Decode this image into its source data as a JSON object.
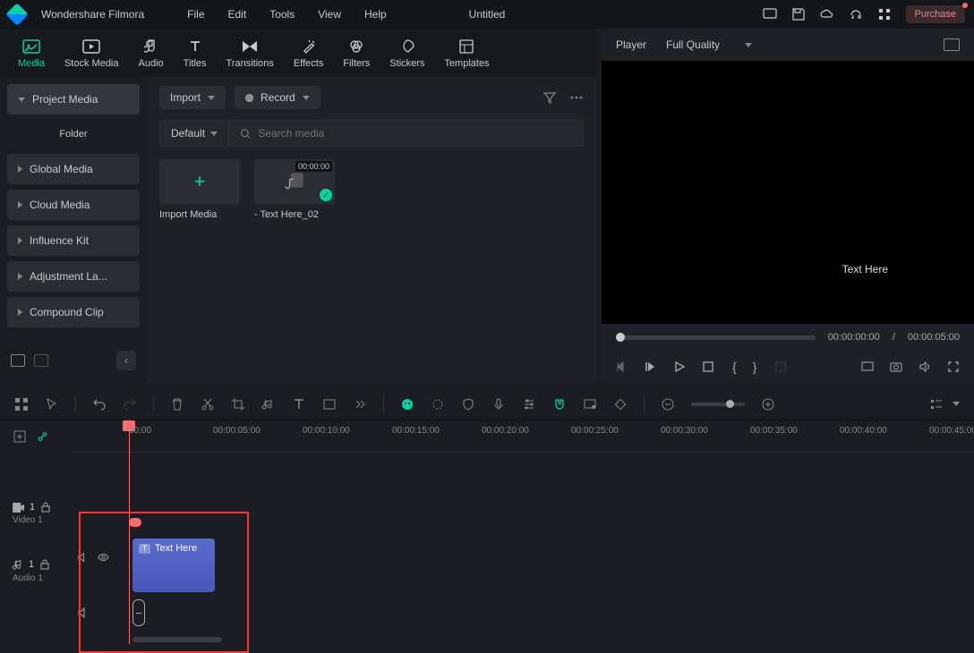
{
  "app": {
    "name": "Wondershare Filmora",
    "document": "Untitled",
    "purchase": "Purchase"
  },
  "menu": {
    "file": "File",
    "edit": "Edit",
    "tools": "Tools",
    "view": "View",
    "help": "Help"
  },
  "tabs": {
    "media": "Media",
    "stock": "Stock Media",
    "audio": "Audio",
    "titles": "Titles",
    "transitions": "Transitions",
    "effects": "Effects",
    "filters": "Filters",
    "stickers": "Stickers",
    "templates": "Templates"
  },
  "sidebar": {
    "project": "Project Media",
    "folder": "Folder",
    "global": "Global Media",
    "cloud": "Cloud Media",
    "influence": "Influence Kit",
    "adjustment": "Adjustment La...",
    "compound": "Compound Clip"
  },
  "content": {
    "import": "Import",
    "record": "Record",
    "default": "Default",
    "search_placeholder": "Search media",
    "import_media": "Import Media",
    "clip_name": "- Text Here_02",
    "clip_duration": "00:00:00"
  },
  "player": {
    "label": "Player",
    "quality": "Full Quality",
    "preview_text": "Text Here",
    "current": "00:00:00:00",
    "total": "00:00:05:00",
    "sep": "/"
  },
  "timeline": {
    "marks": [
      "00:00",
      "00:00:05:00",
      "00:00:10:00",
      "00:00:15:00",
      "00:00:20:00",
      "00:00:25:00",
      "00:00:30:00",
      "00:00:35:00",
      "00:00:40:00",
      "00:00:45:00"
    ],
    "video_track": "Video 1",
    "audio_track": "Audio 1",
    "clip_text": "Text Here",
    "video_num": "1",
    "audio_num": "1"
  }
}
